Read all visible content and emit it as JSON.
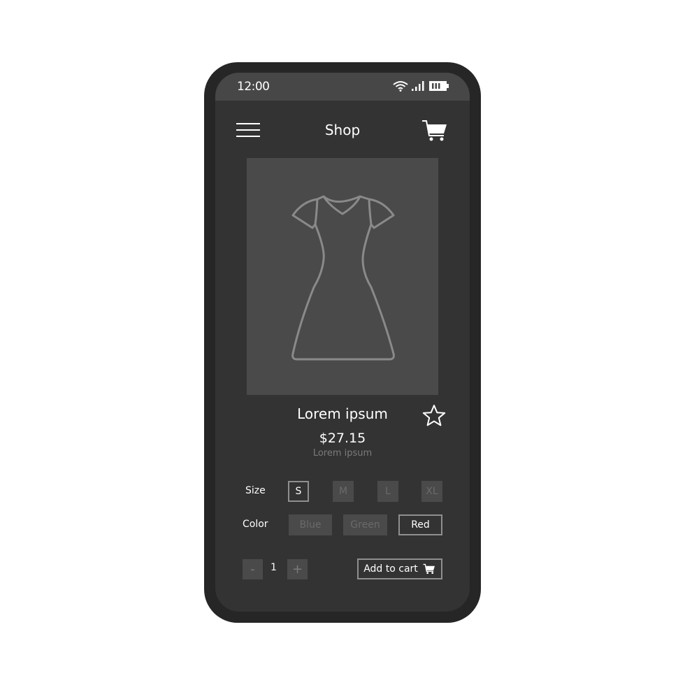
{
  "status_bar": {
    "time": "12:00",
    "icons": [
      "wifi-icon",
      "signal-icon",
      "battery-icon"
    ]
  },
  "header": {
    "title": "Shop",
    "menu_icon": "hamburger-menu-icon",
    "cart_icon": "shopping-cart-icon"
  },
  "product": {
    "image_icon": "dress-icon",
    "name": "Lorem ipsum",
    "price": "$27.15",
    "subtitle": "Lorem ipsum",
    "favorite_icon": "star-outline-icon"
  },
  "size": {
    "label": "Size",
    "options": [
      "S",
      "M",
      "L",
      "XL"
    ],
    "selected": "S"
  },
  "color": {
    "label": "Color",
    "options": [
      "Blue",
      "Green",
      "Red"
    ],
    "selected": "Red"
  },
  "quantity": {
    "minus": "-",
    "value": "1",
    "plus": "+"
  },
  "add_to_cart": {
    "label": "Add to cart",
    "icon": "shopping-cart-icon"
  },
  "colors": {
    "frame": "#262626",
    "screen": "#333333",
    "status_bar": "#474747",
    "image_bg": "#4a4a4a",
    "outline": "#8f8f8f"
  }
}
